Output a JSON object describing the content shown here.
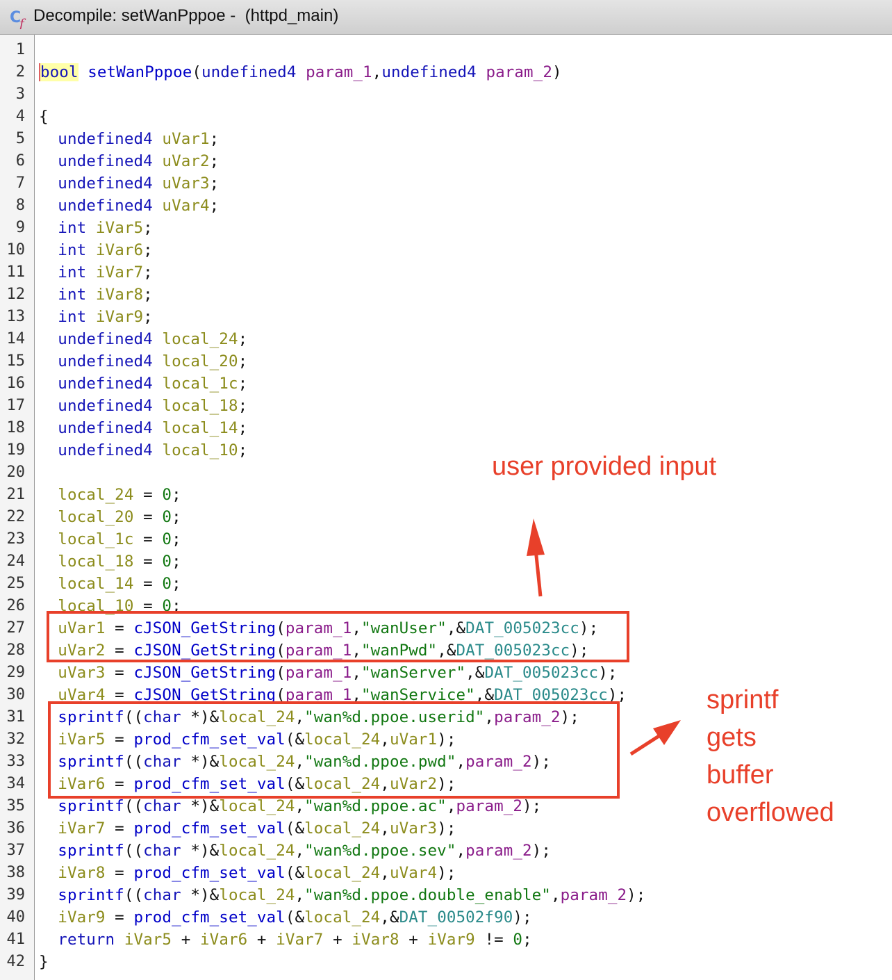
{
  "window": {
    "title": "Decompile: setWanPppoe -  (httpd_main)",
    "icon": "decompiler-cf-icon"
  },
  "line_numbers": [
    "1",
    "2",
    "3",
    "4",
    "5",
    "6",
    "7",
    "8",
    "9",
    "10",
    "11",
    "12",
    "13",
    "14",
    "15",
    "16",
    "17",
    "18",
    "19",
    "20",
    "21",
    "22",
    "23",
    "24",
    "25",
    "26",
    "27",
    "28",
    "29",
    "30",
    "31",
    "32",
    "33",
    "34",
    "35",
    "36",
    "37",
    "38",
    "39",
    "40",
    "41",
    "42"
  ],
  "code": {
    "sig": {
      "ret": "bool",
      "name": "setWanPppoe",
      "t1": "undefined4",
      "p1": "param_1",
      "t2": "undefined4",
      "p2": "param_2"
    },
    "open_brace": "{",
    "close_brace": "}",
    "decls": [
      {
        "type": "undefined4",
        "name": "uVar1"
      },
      {
        "type": "undefined4",
        "name": "uVar2"
      },
      {
        "type": "undefined4",
        "name": "uVar3"
      },
      {
        "type": "undefined4",
        "name": "uVar4"
      },
      {
        "type": "int",
        "name": "iVar5"
      },
      {
        "type": "int",
        "name": "iVar6"
      },
      {
        "type": "int",
        "name": "iVar7"
      },
      {
        "type": "int",
        "name": "iVar8"
      },
      {
        "type": "int",
        "name": "iVar9"
      },
      {
        "type": "undefined4",
        "name": "local_24"
      },
      {
        "type": "undefined4",
        "name": "local_20"
      },
      {
        "type": "undefined4",
        "name": "local_1c"
      },
      {
        "type": "undefined4",
        "name": "local_18"
      },
      {
        "type": "undefined4",
        "name": "local_14"
      },
      {
        "type": "undefined4",
        "name": "local_10"
      }
    ],
    "inits": [
      {
        "name": "local_24",
        "val": "0"
      },
      {
        "name": "local_20",
        "val": "0"
      },
      {
        "name": "local_1c",
        "val": "0"
      },
      {
        "name": "local_18",
        "val": "0"
      },
      {
        "name": "local_14",
        "val": "0"
      },
      {
        "name": "local_10",
        "val": "0"
      }
    ],
    "getstr": [
      {
        "var": "uVar1",
        "fn": "cJSON_GetString",
        "p": "param_1",
        "key": "\"wanUser\"",
        "dat": "DAT_005023cc"
      },
      {
        "var": "uVar2",
        "fn": "cJSON_GetString",
        "p": "param_1",
        "key": "\"wanPwd\"",
        "dat": "DAT_005023cc"
      },
      {
        "var": "uVar3",
        "fn": "cJSON_GetString",
        "p": "param_1",
        "key": "\"wanServer\"",
        "dat": "DAT_005023cc"
      },
      {
        "var": "uVar4",
        "fn": "cJSON_GetString",
        "p": "param_1",
        "key": "\"wanService\"",
        "dat": "DAT_005023cc"
      }
    ],
    "pairs": [
      {
        "sfn": "sprintf",
        "cast": "char",
        "buf": "local_24",
        "fmt": "\"wan%d.ppoe.userid\"",
        "p": "param_2",
        "res": "iVar5",
        "setfn": "prod_cfm_set_val",
        "arg": "uVar1"
      },
      {
        "sfn": "sprintf",
        "cast": "char",
        "buf": "local_24",
        "fmt": "\"wan%d.ppoe.pwd\"",
        "p": "param_2",
        "res": "iVar6",
        "setfn": "prod_cfm_set_val",
        "arg": "uVar2"
      },
      {
        "sfn": "sprintf",
        "cast": "char",
        "buf": "local_24",
        "fmt": "\"wan%d.ppoe.ac\"",
        "p": "param_2",
        "res": "iVar7",
        "setfn": "prod_cfm_set_val",
        "arg": "uVar3"
      },
      {
        "sfn": "sprintf",
        "cast": "char",
        "buf": "local_24",
        "fmt": "\"wan%d.ppoe.sev\"",
        "p": "param_2",
        "res": "iVar8",
        "setfn": "prod_cfm_set_val",
        "arg": "uVar4"
      },
      {
        "sfn": "sprintf",
        "cast": "char",
        "buf": "local_24",
        "fmt": "\"wan%d.ppoe.double_enable\"",
        "p": "param_2",
        "res": "iVar9",
        "setfn": "prod_cfm_set_val",
        "arg": "DAT_00502f90"
      }
    ],
    "ret": {
      "kw": "return",
      "a": "iVar5",
      "b": "iVar6",
      "c": "iVar7",
      "d": "iVar8",
      "e": "iVar9",
      "zero": "0"
    }
  },
  "annotations": {
    "user_input": "user provided input",
    "overflow": [
      "sprintf",
      "gets",
      "buffer",
      "overflowed"
    ],
    "color": "#e8402a"
  }
}
